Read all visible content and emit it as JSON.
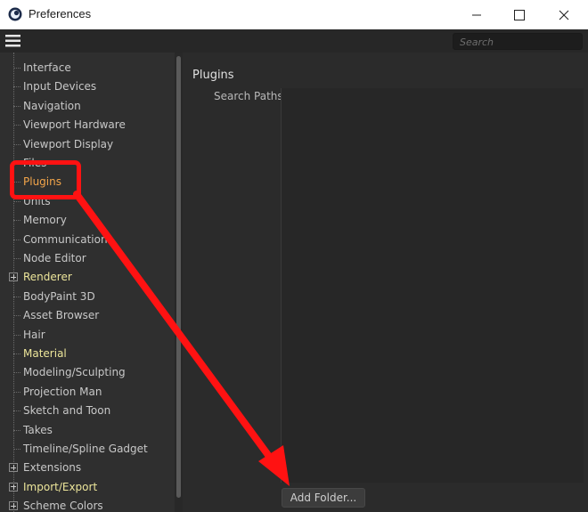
{
  "window": {
    "title": "Preferences"
  },
  "toolbar": {
    "search_placeholder": "Search"
  },
  "tree": {
    "items": [
      {
        "label": "Interface",
        "kind": "leaf"
      },
      {
        "label": "Input Devices",
        "kind": "leaf"
      },
      {
        "label": "Navigation",
        "kind": "leaf"
      },
      {
        "label": "Viewport Hardware",
        "kind": "leaf"
      },
      {
        "label": "Viewport Display",
        "kind": "leaf"
      },
      {
        "label": "Files",
        "kind": "leaf"
      },
      {
        "label": "Plugins",
        "kind": "leaf",
        "selected": true
      },
      {
        "label": "Units",
        "kind": "leaf"
      },
      {
        "label": "Memory",
        "kind": "leaf"
      },
      {
        "label": "Communication",
        "kind": "leaf"
      },
      {
        "label": "Node Editor",
        "kind": "leaf"
      },
      {
        "label": "Renderer",
        "kind": "group"
      },
      {
        "label": "BodyPaint 3D",
        "kind": "leaf"
      },
      {
        "label": "Asset Browser",
        "kind": "leaf"
      },
      {
        "label": "Hair",
        "kind": "leaf"
      },
      {
        "label": "Material",
        "kind": "group-noexpand"
      },
      {
        "label": "Modeling/Sculpting",
        "kind": "leaf"
      },
      {
        "label": "Projection Man",
        "kind": "leaf"
      },
      {
        "label": "Sketch and Toon",
        "kind": "leaf"
      },
      {
        "label": "Takes",
        "kind": "leaf"
      },
      {
        "label": "Timeline/Spline Gadget",
        "kind": "leaf"
      },
      {
        "label": "Extensions",
        "kind": "expandable"
      },
      {
        "label": "Import/Export",
        "kind": "group"
      },
      {
        "label": "Scheme Colors",
        "kind": "expandable"
      }
    ]
  },
  "panel": {
    "title": "Plugins",
    "search_paths_label": "Search Paths",
    "add_folder_label": "Add Folder..."
  },
  "colors": {
    "background": "#2b2b2b",
    "tree_text": "#c8c8c8",
    "group_text": "#ece59a",
    "selected_text": "#f3a54a",
    "annotation": "#ff1212"
  }
}
